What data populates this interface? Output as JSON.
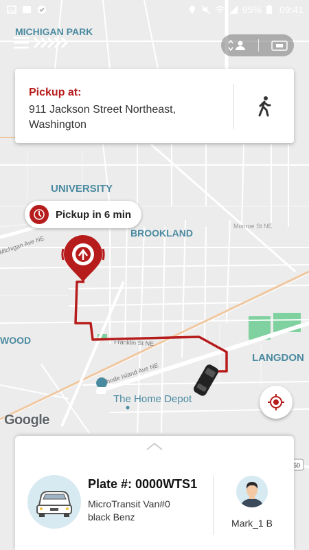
{
  "status_bar": {
    "time": "09:41",
    "battery": "95%"
  },
  "map": {
    "labels": {
      "michigan_park": "MICHIGAN PARK",
      "university": "UNIVERSITY",
      "brookland": "BROOKLAND",
      "langdon": "LANGDON",
      "wood": "WOOD",
      "home_depot": "The Home Depot",
      "michigan_ave": "Michigan Ave NE",
      "franklin_st": "Franklin St NE",
      "rhode_island_ave": "Rhode Island Ave NE",
      "monroe_st": "Monroe St NE",
      "route_50": "50"
    },
    "attribution": "Google"
  },
  "pickup": {
    "label": "Pickup at:",
    "address": "911 Jackson Street Northeast, Washington"
  },
  "eta": {
    "text": "Pickup in 6 min"
  },
  "ride": {
    "plate": "Plate #: 0000WTS1",
    "vehicle_name": "MicroTransit Van#0",
    "vehicle_desc": "black Benz",
    "driver_name": "Mark_1 B"
  },
  "colors": {
    "accent": "#b71c1c",
    "route": "#b71c1c",
    "map_label": "#4a8aa0"
  }
}
